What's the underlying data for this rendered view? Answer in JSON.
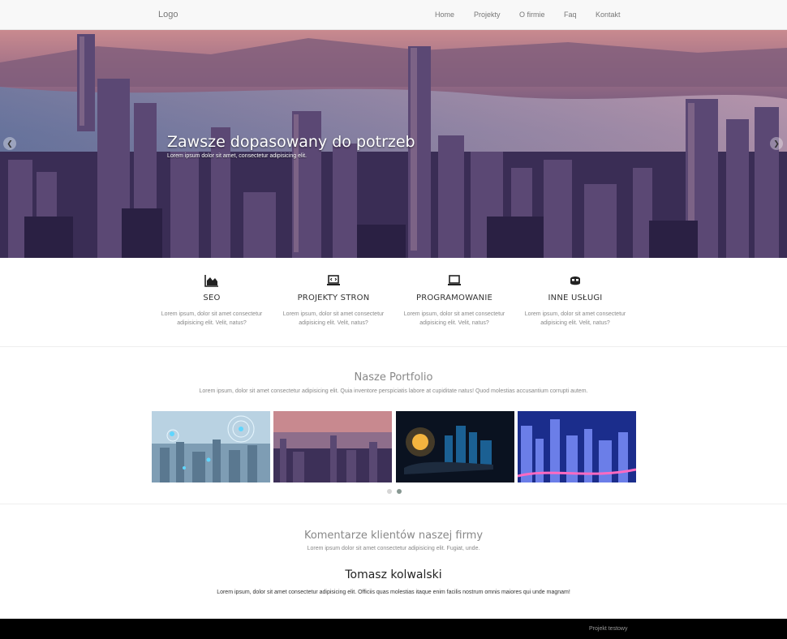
{
  "nav": {
    "logo": "Logo",
    "links": [
      "Home",
      "Projekty",
      "O firmie",
      "Faq",
      "Kontakt"
    ]
  },
  "hero": {
    "title": "Zawsze dopasowany do potrzeb",
    "subtitle": "Lorem ipsum dolor sit amet, consectetur adipisicing elit.",
    "prev_icon": "chevron-left-icon",
    "next_icon": "chevron-right-icon"
  },
  "services": [
    {
      "icon": "area-chart-icon",
      "title": "SEO",
      "text": "Lorem ipsum, dolor sit amet consectetur adipisicing elit. Velit, natus?"
    },
    {
      "icon": "code-laptop-icon",
      "title": "PROJEKTY STRON",
      "text": "Lorem ipsum, dolor sit amet consectetur adipisicing elit. Velit, natus?"
    },
    {
      "icon": "laptop-icon",
      "title": "PROGRAMOWANIE",
      "text": "Lorem ipsum, dolor sit amet consectetur adipisicing elit. Velit, natus?"
    },
    {
      "icon": "mask-icon",
      "title": "INNE USŁUGI",
      "text": "Lorem ipsum, dolor sit amet consectetur adipisicing elit. Velit, natus?"
    }
  ],
  "portfolio": {
    "title": "Nasze Portfolio",
    "subtitle": "Lorem ipsum, dolor sit amet consectetur adipisicing elit. Quia inventore perspiciatis labore at cupiditate natus! Quod molestias accusantium corrupti autem.",
    "carousel_pages": 2,
    "active_page": 2
  },
  "testimonials": {
    "title": "Komentarze klientów naszej firmy",
    "subtitle": "Lorem ipsum dolor sit amet consectetur adipisicing elit. Fugiat, unde.",
    "name": "Tomasz kolwalski",
    "text": "Lorem ipsum, dolor sit amet consectetur adipisicing elit. Officiis quas molestias itaque enim facilis nostrum omnis maiores qui unde magnam!"
  },
  "footer": {
    "text": "Projekt testowy"
  },
  "colors": {
    "nav_bg": "#f8f8f8",
    "footer_bg": "#000000",
    "dot_active": "#869791",
    "dot_inactive": "#d6d6d6"
  }
}
